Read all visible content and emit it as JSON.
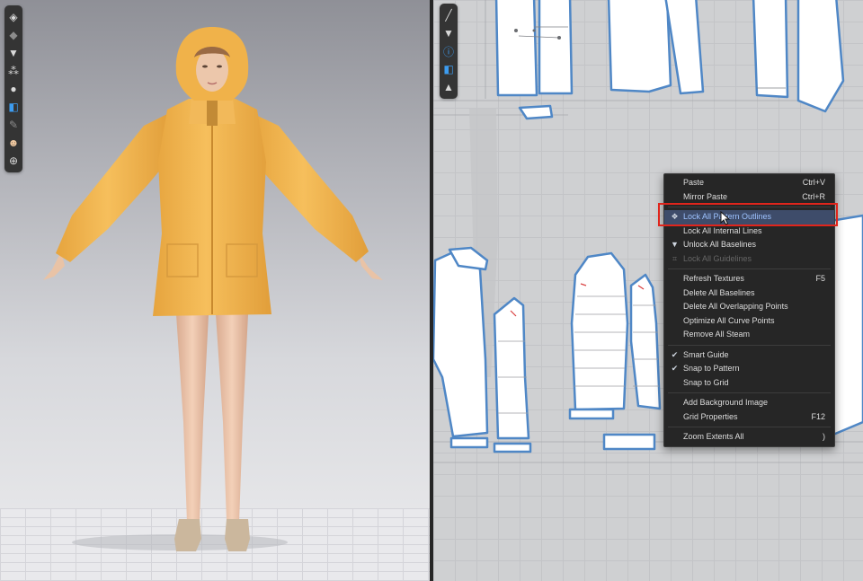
{
  "toolbar_3d": [
    {
      "icon": "cube-icon",
      "glyph": "◈",
      "tone": ""
    },
    {
      "icon": "shirt-outline-icon",
      "glyph": "◆",
      "tone": "dim"
    },
    {
      "icon": "shirt-icon",
      "glyph": "▼",
      "tone": ""
    },
    {
      "icon": "avatar-points-icon",
      "glyph": "⁂",
      "tone": ""
    },
    {
      "icon": "avatar-icon",
      "glyph": "●",
      "tone": ""
    },
    {
      "icon": "texture-icon",
      "glyph": "◧",
      "tone": "blue"
    },
    {
      "icon": "pencil-icon",
      "glyph": "✎",
      "tone": "dim"
    },
    {
      "icon": "skin-icon",
      "glyph": "☻",
      "tone": "skin"
    },
    {
      "icon": "globe-icon",
      "glyph": "⊕",
      "tone": ""
    }
  ],
  "toolbar_2d": [
    {
      "icon": "pen-tool-icon",
      "glyph": "╱",
      "tone": ""
    },
    {
      "icon": "shirt-icon",
      "glyph": "▼",
      "tone": ""
    },
    {
      "icon": "info-icon",
      "glyph": "ⓘ",
      "tone": "blue"
    },
    {
      "icon": "texture-icon",
      "glyph": "◧",
      "tone": "blue"
    },
    {
      "icon": "garment-icon",
      "glyph": "▲",
      "tone": ""
    }
  ],
  "context_menu": {
    "groups": [
      [
        {
          "label": "Paste",
          "shortcut": "Ctrl+V",
          "icon": "",
          "state": "normal"
        },
        {
          "label": "Mirror Paste",
          "shortcut": "Ctrl+R",
          "icon": "",
          "state": "normal"
        }
      ],
      [
        {
          "label": "Lock All Pattern Outlines",
          "shortcut": "",
          "icon": "lock-pattern-icon",
          "state": "highlight"
        },
        {
          "label": "Lock All Internal Lines",
          "shortcut": "",
          "icon": "",
          "state": "normal"
        },
        {
          "label": "Unlock All Baselines",
          "shortcut": "",
          "icon": "unlock-icon",
          "state": "normal"
        },
        {
          "label": "Lock All Guidelines",
          "shortcut": "",
          "icon": "guideline-icon",
          "state": "disabled"
        }
      ],
      [
        {
          "label": "Refresh Textures",
          "shortcut": "F5",
          "icon": "",
          "state": "normal"
        },
        {
          "label": "Delete All Baselines",
          "shortcut": "",
          "icon": "",
          "state": "normal"
        },
        {
          "label": "Delete All Overlapping Points",
          "shortcut": "",
          "icon": "",
          "state": "normal"
        },
        {
          "label": "Optimize All Curve Points",
          "shortcut": "",
          "icon": "",
          "state": "normal"
        },
        {
          "label": "Remove All Steam",
          "shortcut": "",
          "icon": "",
          "state": "normal"
        }
      ],
      [
        {
          "label": "Smart Guide",
          "shortcut": "",
          "icon": "check-icon",
          "state": "normal"
        },
        {
          "label": "Snap to Pattern",
          "shortcut": "",
          "icon": "check-icon",
          "state": "normal"
        },
        {
          "label": "Snap to Grid",
          "shortcut": "",
          "icon": "",
          "state": "normal"
        }
      ],
      [
        {
          "label": "Add Background Image",
          "shortcut": "",
          "icon": "",
          "state": "normal"
        },
        {
          "label": "Grid Properties",
          "shortcut": "F12",
          "icon": "",
          "state": "normal"
        }
      ],
      [
        {
          "label": "Zoom Extents All",
          "shortcut": ")",
          "icon": "",
          "state": "normal"
        }
      ]
    ]
  },
  "icon_glyphs": {
    "lock-pattern-icon": "❖",
    "unlock-icon": "▼",
    "guideline-icon": "⌗",
    "check-icon": "✔"
  },
  "colors": {
    "highlight_box": "#e0251c",
    "coat": "#f0b24a",
    "pattern_outline": "#4f87c6"
  }
}
